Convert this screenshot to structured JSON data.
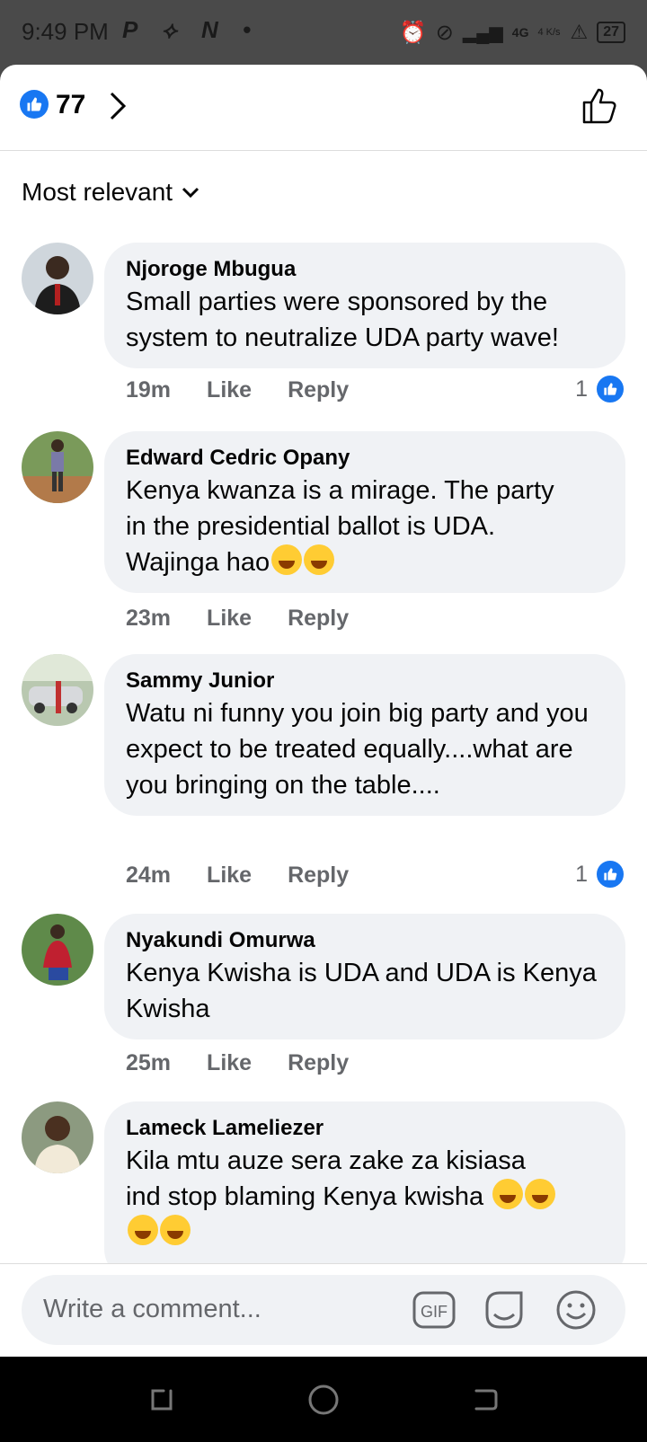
{
  "status": {
    "time": "9:49 PM",
    "apps": "P ⟡ N •",
    "network": "4G",
    "speed": "4 K/s",
    "battery": "27"
  },
  "header": {
    "like_count": "77"
  },
  "sort": {
    "label": "Most relevant"
  },
  "comments": [
    {
      "author": "Njoroge Mbugua",
      "text": "Small parties were sponsored by the system to neutralize UDA party wave!",
      "time": "19m",
      "like": "Like",
      "reply": "Reply",
      "reactions": "1"
    },
    {
      "author": "Edward Cedric Opany",
      "text_l1": "Kenya kwanza is a mirage. The party",
      "text_l2": "in the presidential ballot is UDA.",
      "text_l3": "Wajinga hao",
      "time": "23m",
      "like": "Like",
      "reply": "Reply"
    },
    {
      "author": "Sammy Junior",
      "text": "Watu ni funny you join big party and you expect to be treated equally....what are you bringing on the table....",
      "time": "24m",
      "like": "Like",
      "reply": "Reply",
      "reactions": "1"
    },
    {
      "author": "Nyakundi Omurwa",
      "text": "Kenya Kwisha is UDA and UDA is Kenya Kwisha",
      "time": "25m",
      "like": "Like",
      "reply": "Reply"
    },
    {
      "author": "Lameck Lameliezer",
      "text_l1": "Kila mtu auze sera zake za kisiasa",
      "text_l2": "ind stop blaming Kenya kwisha"
    }
  ],
  "composer": {
    "placeholder": "Write a comment...",
    "gif_label": "GIF"
  },
  "colors": {
    "accent": "#1877f2",
    "bubble": "#f0f2f5",
    "meta": "#65676b"
  }
}
